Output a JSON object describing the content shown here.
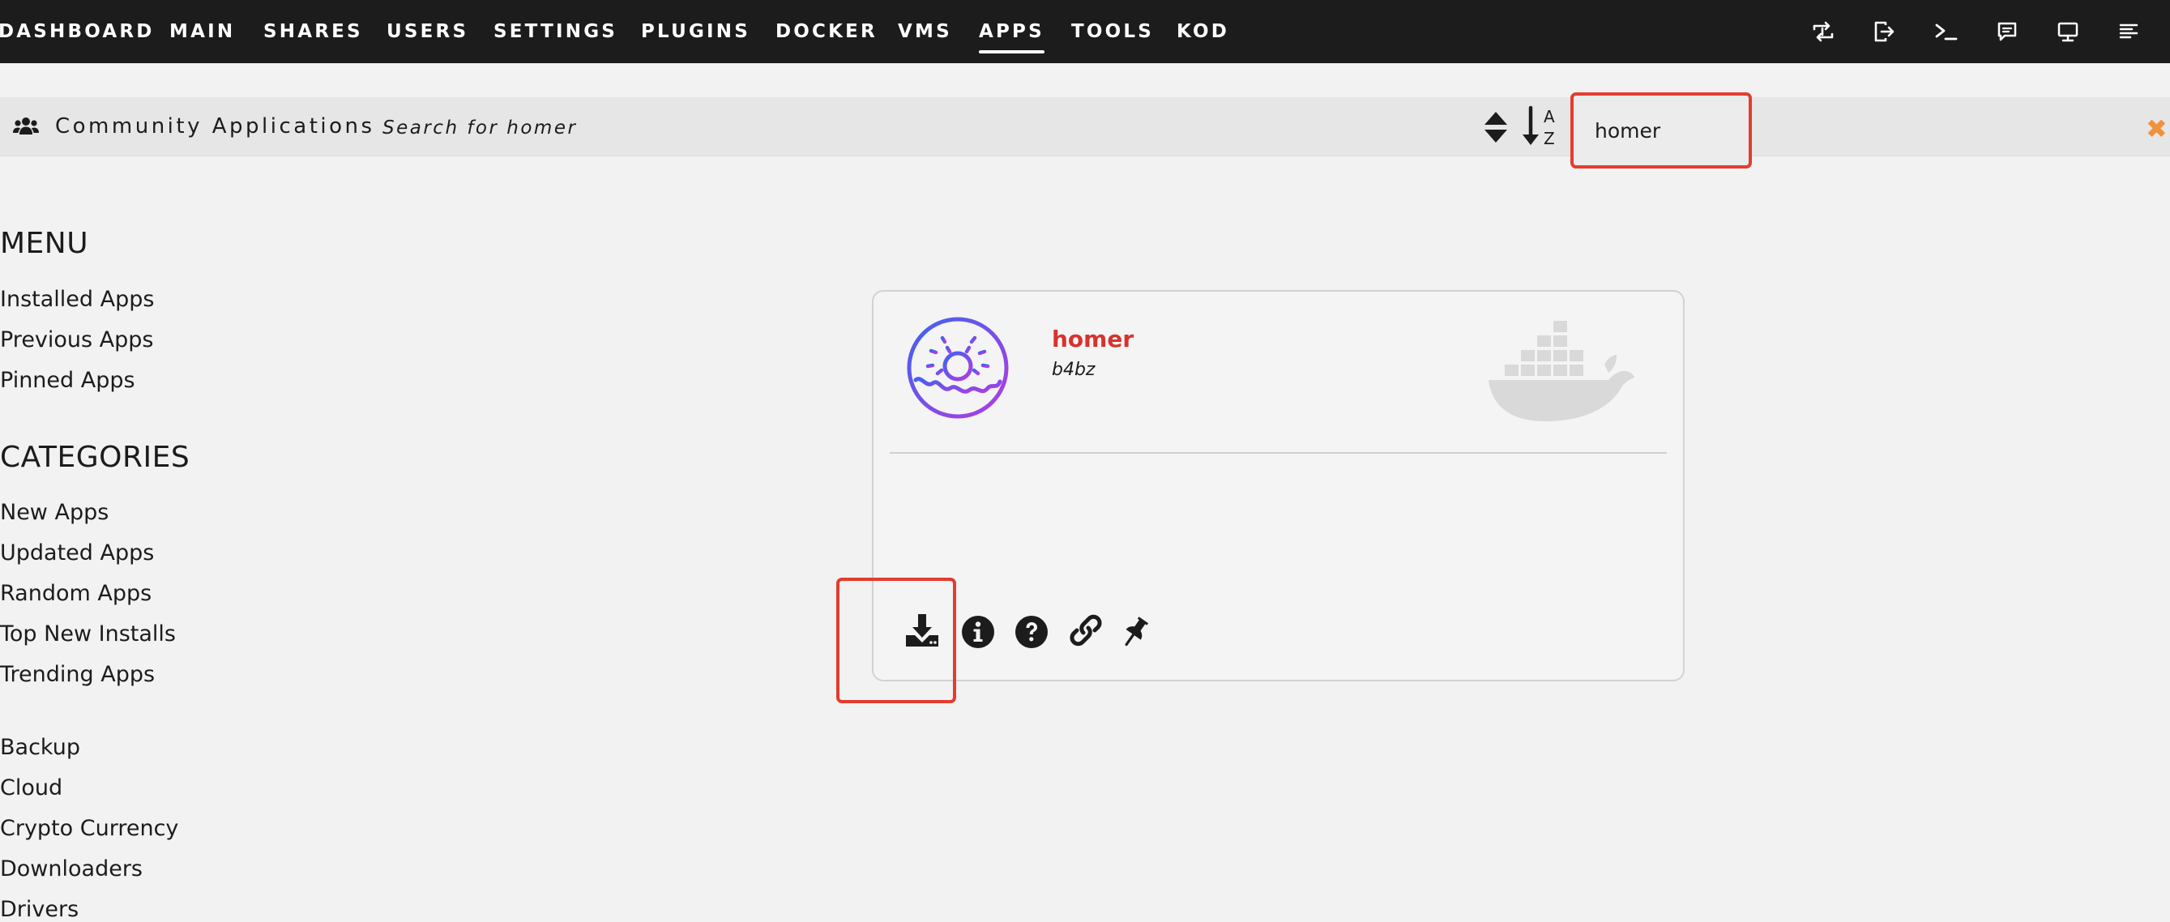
{
  "nav": {
    "tabs": [
      {
        "label": "DASHBOARD"
      },
      {
        "label": "MAIN"
      },
      {
        "label": "SHARES"
      },
      {
        "label": "USERS"
      },
      {
        "label": "SETTINGS"
      },
      {
        "label": "PLUGINS"
      },
      {
        "label": "DOCKER"
      },
      {
        "label": "VMS"
      },
      {
        "label": "APPS"
      },
      {
        "label": "TOOLS"
      },
      {
        "label": "KOD"
      }
    ],
    "active_tab": "APPS",
    "icons": [
      "switch-icon",
      "logout-icon",
      "terminal-icon",
      "feedback-icon",
      "monitor-icon",
      "log-icon"
    ]
  },
  "header": {
    "title": "Community Applications",
    "search_label": "Search for homer",
    "search_value": "homer"
  },
  "menu": {
    "heading": "MENU",
    "items": [
      {
        "label": "Installed Apps"
      },
      {
        "label": "Previous Apps"
      },
      {
        "label": "Pinned Apps"
      }
    ]
  },
  "categories": {
    "heading": "CATEGORIES",
    "items": [
      {
        "label": "New Apps"
      },
      {
        "label": "Updated Apps"
      },
      {
        "label": "Random Apps"
      },
      {
        "label": "Top New Installs"
      },
      {
        "label": "Trending Apps"
      }
    ],
    "groups": [
      {
        "label": "Backup"
      },
      {
        "label": "Cloud"
      },
      {
        "label": "Crypto Currency"
      },
      {
        "label": "Downloaders"
      },
      {
        "label": "Drivers"
      }
    ]
  },
  "app_card": {
    "name": "homer",
    "author": "b4bz",
    "actions": [
      "install-icon",
      "info-icon",
      "help-icon",
      "link-icon",
      "pin-icon"
    ]
  },
  "colors": {
    "nav_bg": "#1c1c1c",
    "accent_red": "#d8322c",
    "highlight": "#e43c2f",
    "close_orange": "#f0913c"
  }
}
